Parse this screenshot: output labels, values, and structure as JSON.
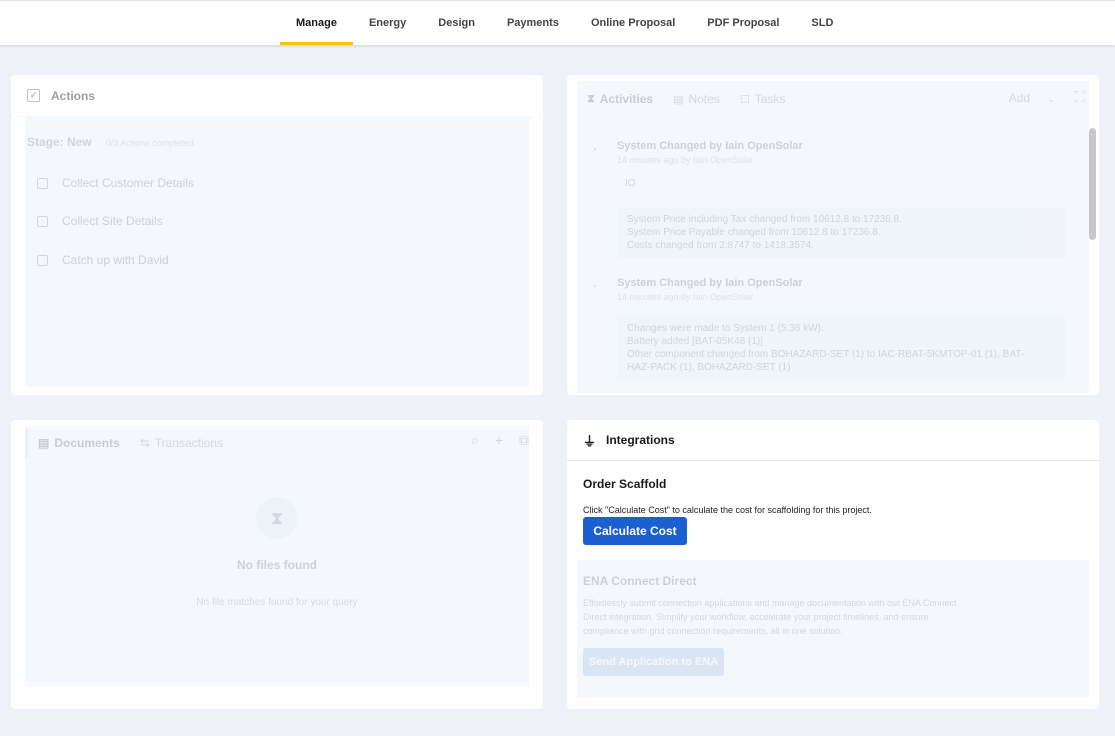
{
  "nav": {
    "tabs": [
      {
        "label": "Manage",
        "active": true
      },
      {
        "label": "Energy"
      },
      {
        "label": "Design"
      },
      {
        "label": "Payments"
      },
      {
        "label": "Online Proposal"
      },
      {
        "label": "PDF Proposal"
      },
      {
        "label": "SLD"
      }
    ],
    "accent_color": "#f5c518"
  },
  "actions": {
    "title": "Actions",
    "stage_label": "Stage: New",
    "progress": "0/3 Actions completed",
    "items": [
      {
        "label": "Collect Customer Details",
        "checked": false
      },
      {
        "label": "Collect Site Details",
        "checked": false
      },
      {
        "label": "Catch up with David",
        "checked": false
      }
    ]
  },
  "activities": {
    "tabs": [
      "Activities",
      "Notes",
      "Tasks"
    ],
    "add_label": "Add",
    "entries": [
      {
        "title": "System Changed by Iain OpenSolar",
        "time": "14 minutes ago by Iain OpenSolar",
        "note": "IO",
        "lines": [
          "System Price including Tax changed from 10612.8 to 17236.8.",
          "System Price Payable changed from 10612.8 to 17236.8.",
          "Costs changed from 2.8747 to 1418.3574."
        ]
      },
      {
        "title": "System Changed by Iain OpenSolar",
        "time": "14 minutes ago by Iain OpenSolar",
        "lines": [
          "Changes were made to System 1 (5.36 kW):",
          "Battery added [BAT-05K48 (1)]",
          "Other component changed from BOHAZARD-SET (1) to IAC-RBAT-5KMTOP-01 (1), BAT-",
          "HAZ-PACK (1), BOHAZARD-SET (1)"
        ]
      }
    ]
  },
  "documents": {
    "tabs": [
      "Documents",
      "Transactions"
    ],
    "empty_title": "No files found",
    "empty_subtitle": "No file matches found for your query"
  },
  "integrations": {
    "title": "Integrations",
    "scaffold": {
      "title": "Order Scaffold",
      "description": "Click \"Calculate Cost\" to calculate the cost for scaffolding for this project.",
      "button": "Calculate Cost",
      "button_color": "#1c5fd0"
    },
    "ena": {
      "title": "ENA Connect Direct",
      "description": "Effortlessly submit connection applications and manage documentation with our ENA Connect Direct integration. Simplify your workflow, accelerate your project timelines, and ensure compliance with grid connection requirements, all in one solution.",
      "button": "Send Application to ENA"
    }
  }
}
